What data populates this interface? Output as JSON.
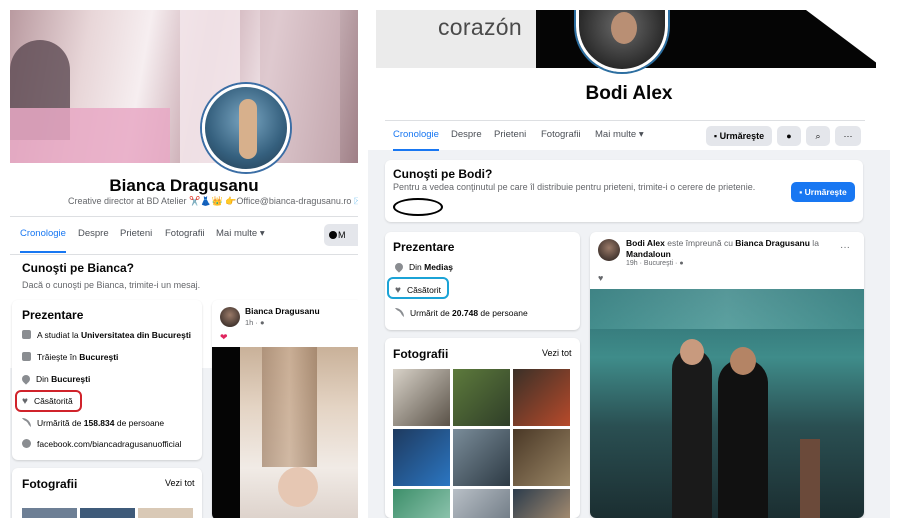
{
  "left": {
    "name": "Bianca Dragusanu",
    "subtitle": "Creative director at BD Atelier ✂️👗👑 👉Office@bianca-dragusanu.ro ✉️",
    "tabs": [
      "Cronologie",
      "Despre",
      "Prieteni",
      "Fotografii",
      "Mai multe ▾"
    ],
    "tab_button": "M",
    "know_title": "Cunoşti pe Bianca?",
    "know_sub": "Dacă o cunoşti pe Bianca, trimite-i un mesaj.",
    "intro_title": "Prezentare",
    "intro": {
      "studied_prefix": "A studiat la ",
      "studied_school": "Universitatea din Bucureşti",
      "lives_prefix": "Trăieşte în ",
      "lives_city": "Bucureşti",
      "from_prefix": "Din ",
      "from_city": "Bucureşti",
      "relationship": "Căsătorită",
      "followers_prefix": "Urmărită de ",
      "followers_count": "158.834",
      "followers_suffix": " de persoane",
      "facebook_link": "facebook.com/biancadragusanuofficial"
    },
    "photos_title": "Fotografii",
    "see_all": "Vezi tot",
    "post": {
      "author": "Bianca Dragusanu",
      "time": "1h · ",
      "reaction": "❤"
    }
  },
  "right": {
    "cover_text": "corazón",
    "name": "Bodi Alex",
    "tabs": [
      "Cronologie",
      "Despre",
      "Prieteni",
      "Fotografii",
      "Mai multe ▾"
    ],
    "follow_button": "Urmăreşte",
    "messenger_icon": "messenger-icon",
    "search_icon": "search-icon",
    "more_label": "···",
    "know_title": "Cunoşti pe Bodi?",
    "know_sub": "Pentru a vedea conţinutul pe care îl distribuie pentru prieteni, trimite-i o cerere de prietenie.",
    "add_friend": "Urmăreşte",
    "intro_title": "Prezentare",
    "intro": {
      "from_prefix": "Din ",
      "from_city": "Mediaş",
      "relationship": "Căsătorit",
      "followers_prefix": "Urmărit de ",
      "followers_count": "20.748",
      "followers_suffix": " de persoane"
    },
    "photos_title": "Fotografii",
    "see_all": "Vezi tot",
    "post": {
      "author": "Bodi Alex",
      "with_text": " este împreună cu ",
      "with_name": "Bianca Dragusanu",
      "location_prefix": " la ",
      "location": "Mandaloun",
      "time": "19h · Bucureşti · ",
      "reaction": "♥",
      "more": "···"
    }
  },
  "colors": {
    "fb_blue": "#1877f2",
    "highlight_red": "#d0232b",
    "highlight_blue": "#1ba3d6"
  }
}
